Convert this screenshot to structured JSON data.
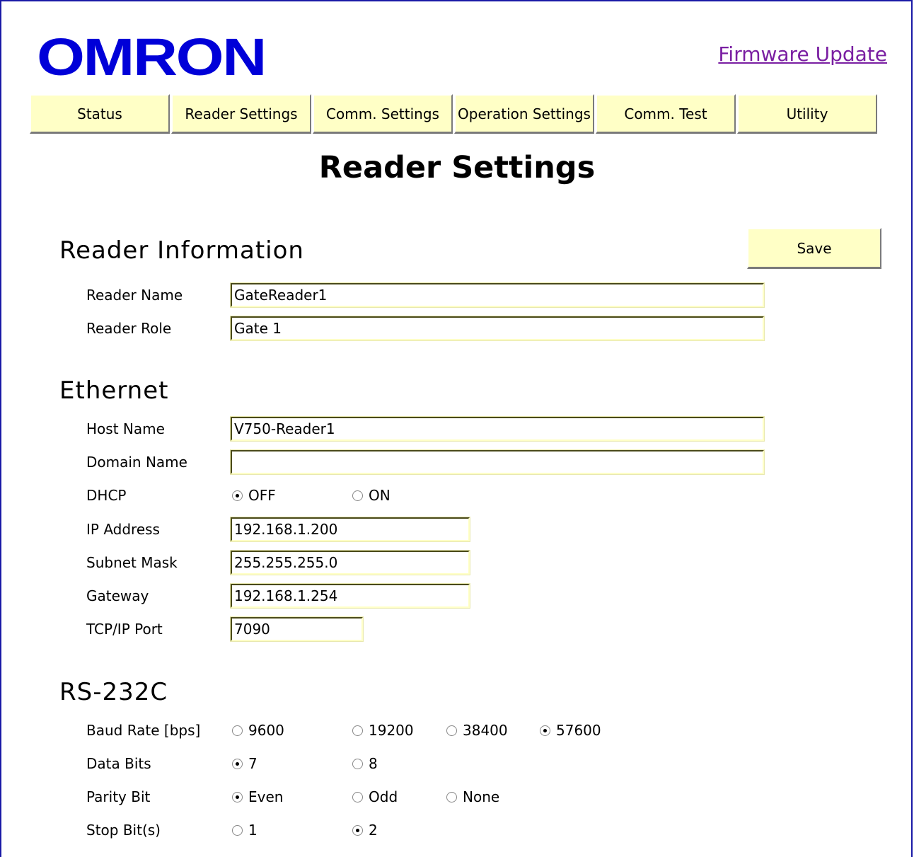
{
  "header": {
    "logo_text": "OMRON",
    "firmware_link": "Firmware Update"
  },
  "tabs": [
    {
      "label": "Status"
    },
    {
      "label": "Reader Settings"
    },
    {
      "label": "Comm. Settings"
    },
    {
      "label": "Operation Settings"
    },
    {
      "label": "Comm. Test"
    },
    {
      "label": "Utility"
    }
  ],
  "page_title": "Reader Settings",
  "save_label": "Save",
  "reader_info": {
    "title": "Reader Information",
    "reader_name_label": "Reader Name",
    "reader_name_value": "GateReader1",
    "reader_role_label": "Reader Role",
    "reader_role_value": "Gate 1"
  },
  "ethernet": {
    "title": "Ethernet",
    "host_name_label": "Host Name",
    "host_name_value": "V750-Reader1",
    "domain_name_label": "Domain Name",
    "domain_name_value": "",
    "dhcp_label": "DHCP",
    "dhcp_options": [
      "OFF",
      "ON"
    ],
    "dhcp_selected": "OFF",
    "ip_label": "IP Address",
    "ip_value": "192.168.1.200",
    "subnet_label": "Subnet Mask",
    "subnet_value": "255.255.255.0",
    "gateway_label": "Gateway",
    "gateway_value": "192.168.1.254",
    "port_label": "TCP/IP Port",
    "port_value": "7090"
  },
  "rs232c": {
    "title": "RS-232C",
    "baud_label": "Baud Rate [bps]",
    "baud_options": [
      "9600",
      "19200",
      "38400",
      "57600"
    ],
    "baud_selected": "57600",
    "data_bits_label": "Data Bits",
    "data_bits_options": [
      "7",
      "8"
    ],
    "data_bits_selected": "7",
    "parity_label": "Parity Bit",
    "parity_options": [
      "Even",
      "Odd",
      "None"
    ],
    "parity_selected": "Even",
    "stop_bits_label": "Stop Bit(s)",
    "stop_bits_options": [
      "1",
      "2"
    ],
    "stop_bits_selected": "2"
  },
  "colors": {
    "logo": "#0000d8",
    "tab_background": "#ffffc6",
    "link": "#7a1fa2",
    "frame": "#1a1aa6"
  }
}
